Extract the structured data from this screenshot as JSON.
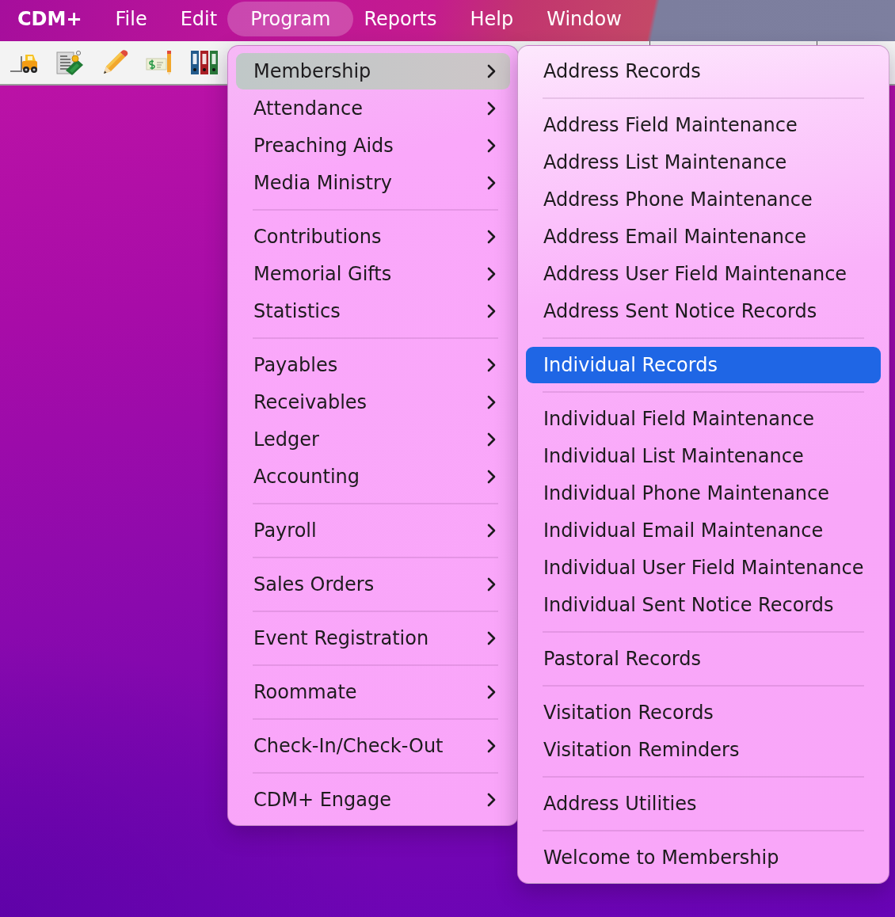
{
  "menu_bar": {
    "items": [
      {
        "kind": "app",
        "label": "CDM+",
        "selected": false
      },
      {
        "kind": "menu",
        "label": "File",
        "selected": false
      },
      {
        "kind": "menu",
        "label": "Edit",
        "selected": false
      },
      {
        "kind": "menu",
        "label": "Program",
        "selected": true
      },
      {
        "kind": "menu",
        "label": "Reports",
        "selected": false
      },
      {
        "kind": "menu",
        "label": "Help",
        "selected": false
      },
      {
        "kind": "menu",
        "label": "Window",
        "selected": false
      }
    ]
  },
  "program_menu": {
    "focused": false,
    "items": [
      {
        "kind": "item",
        "label": "Membership",
        "submenu": true,
        "selected": true
      },
      {
        "kind": "item",
        "label": "Attendance",
        "submenu": true,
        "selected": false
      },
      {
        "kind": "item",
        "label": "Preaching Aids",
        "submenu": true,
        "selected": false
      },
      {
        "kind": "item",
        "label": "Media Ministry",
        "submenu": true,
        "selected": false
      },
      {
        "kind": "separator"
      },
      {
        "kind": "item",
        "label": "Contributions",
        "submenu": true,
        "selected": false
      },
      {
        "kind": "item",
        "label": "Memorial Gifts",
        "submenu": true,
        "selected": false
      },
      {
        "kind": "item",
        "label": "Statistics",
        "submenu": true,
        "selected": false
      },
      {
        "kind": "separator"
      },
      {
        "kind": "item",
        "label": "Payables",
        "submenu": true,
        "selected": false
      },
      {
        "kind": "item",
        "label": "Receivables",
        "submenu": true,
        "selected": false
      },
      {
        "kind": "item",
        "label": "Ledger",
        "submenu": true,
        "selected": false
      },
      {
        "kind": "item",
        "label": "Accounting",
        "submenu": true,
        "selected": false
      },
      {
        "kind": "separator"
      },
      {
        "kind": "item",
        "label": "Payroll",
        "submenu": true,
        "selected": false
      },
      {
        "kind": "separator"
      },
      {
        "kind": "item",
        "label": "Sales Orders",
        "submenu": true,
        "selected": false
      },
      {
        "kind": "separator"
      },
      {
        "kind": "item",
        "label": "Event Registration",
        "submenu": true,
        "selected": false
      },
      {
        "kind": "separator"
      },
      {
        "kind": "item",
        "label": "Roommate",
        "submenu": true,
        "selected": false
      },
      {
        "kind": "separator"
      },
      {
        "kind": "item",
        "label": "Check-In/Check-Out",
        "submenu": true,
        "selected": false
      },
      {
        "kind": "separator"
      },
      {
        "kind": "item",
        "label": "CDM+ Engage",
        "submenu": true,
        "selected": false
      }
    ]
  },
  "membership_submenu": {
    "focused": true,
    "items": [
      {
        "kind": "item",
        "label": "Address Records",
        "selected": false
      },
      {
        "kind": "separator"
      },
      {
        "kind": "item",
        "label": "Address Field Maintenance",
        "selected": false
      },
      {
        "kind": "item",
        "label": "Address List Maintenance",
        "selected": false
      },
      {
        "kind": "item",
        "label": "Address Phone Maintenance",
        "selected": false
      },
      {
        "kind": "item",
        "label": "Address Email Maintenance",
        "selected": false
      },
      {
        "kind": "item",
        "label": "Address User Field Maintenance",
        "selected": false
      },
      {
        "kind": "item",
        "label": "Address Sent Notice Records",
        "selected": false
      },
      {
        "kind": "separator"
      },
      {
        "kind": "item",
        "label": "Individual Records",
        "selected": true
      },
      {
        "kind": "separator"
      },
      {
        "kind": "item",
        "label": "Individual Field Maintenance",
        "selected": false
      },
      {
        "kind": "item",
        "label": "Individual List Maintenance",
        "selected": false
      },
      {
        "kind": "item",
        "label": "Individual Phone Maintenance",
        "selected": false
      },
      {
        "kind": "item",
        "label": "Individual Email Maintenance",
        "selected": false
      },
      {
        "kind": "item",
        "label": "Individual User Field Maintenance",
        "selected": false
      },
      {
        "kind": "item",
        "label": "Individual Sent Notice Records",
        "selected": false
      },
      {
        "kind": "separator"
      },
      {
        "kind": "item",
        "label": "Pastoral Records",
        "selected": false
      },
      {
        "kind": "separator"
      },
      {
        "kind": "item",
        "label": "Visitation Records",
        "selected": false
      },
      {
        "kind": "item",
        "label": "Visitation Reminders",
        "selected": false
      },
      {
        "kind": "separator"
      },
      {
        "kind": "item",
        "label": "Address Utilities",
        "selected": false
      },
      {
        "kind": "separator"
      },
      {
        "kind": "item",
        "label": "Welcome to Membership",
        "selected": false
      }
    ]
  }
}
